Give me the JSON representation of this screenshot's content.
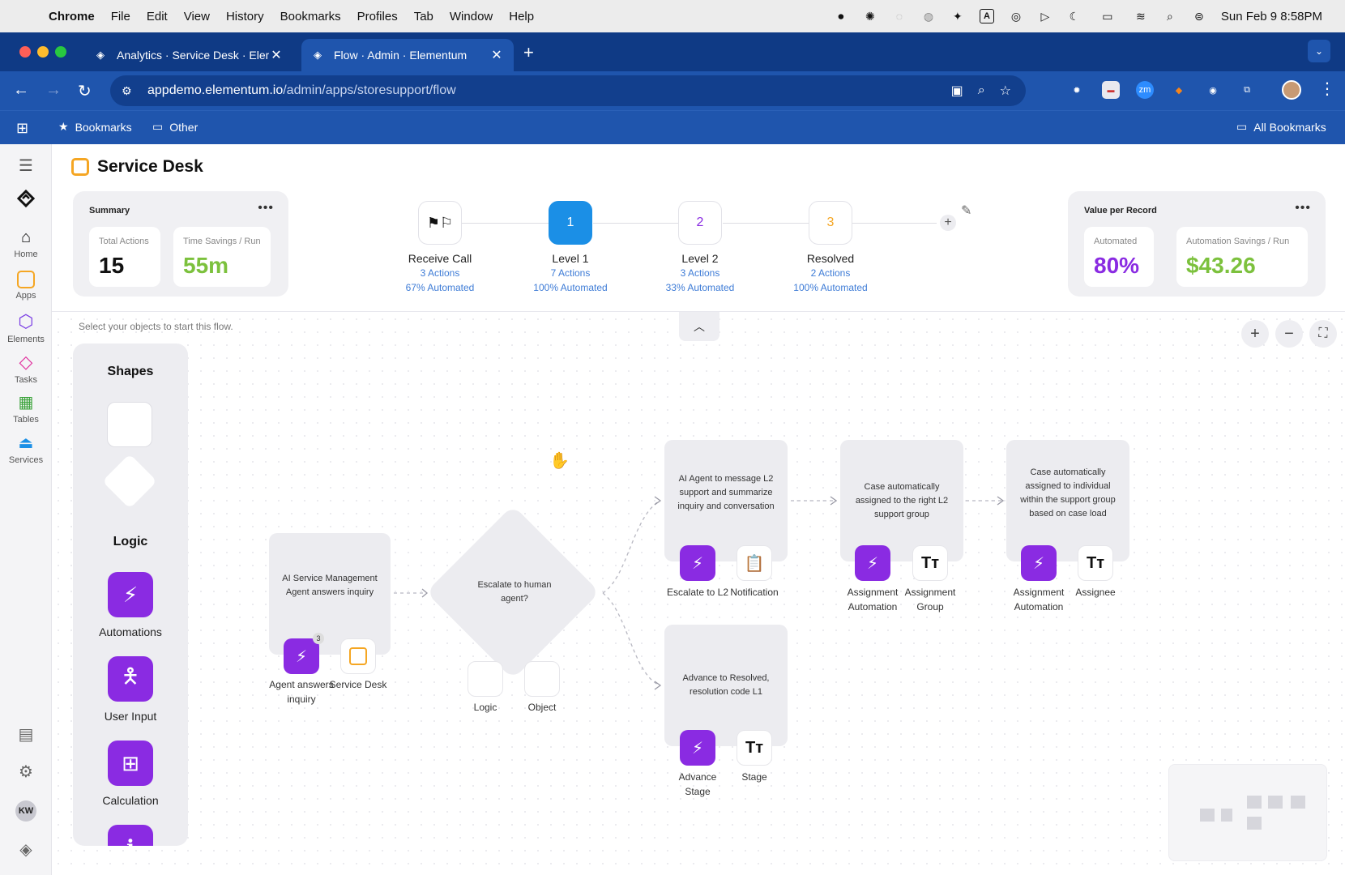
{
  "menubar": {
    "app": "Chrome",
    "items": [
      "File",
      "Edit",
      "View",
      "History",
      "Bookmarks",
      "Profiles",
      "Tab",
      "Window",
      "Help"
    ],
    "clock": "Sun Feb 9  8:58PM"
  },
  "browser": {
    "tabs": [
      {
        "label": "Analytics · Service Desk · Elementum"
      },
      {
        "label": "Flow · Admin · Elementum"
      }
    ],
    "url_host": "appdemo.elementum.io",
    "url_path": "/admin/apps/storesupport/flow",
    "bookmarks": {
      "bookmarks": "Bookmarks",
      "other": "Other",
      "all": "All Bookmarks"
    },
    "extensions": {
      "zm": "zm"
    }
  },
  "rail": {
    "items": [
      "Home",
      "Apps",
      "Elements",
      "Tasks",
      "Tables",
      "Services"
    ],
    "avatar": "KW"
  },
  "header": {
    "title": "Service Desk"
  },
  "summary": {
    "title": "Summary",
    "total_actions_label": "Total Actions",
    "total_actions": "15",
    "time_savings_label": "Time Savings / Run",
    "time_savings": "55m"
  },
  "stages": [
    {
      "badge": "",
      "name": "Receive Call",
      "actions": "3 Actions",
      "automated": "67% Automated"
    },
    {
      "badge": "1",
      "name": "Level 1",
      "actions": "7 Actions",
      "automated": "100% Automated"
    },
    {
      "badge": "2",
      "name": "Level 2",
      "actions": "3 Actions",
      "automated": "33% Automated"
    },
    {
      "badge": "3",
      "name": "Resolved",
      "actions": "2 Actions",
      "automated": "100% Automated"
    }
  ],
  "value_card": {
    "title": "Value per Record",
    "automated_label": "Automated",
    "automated": "80%",
    "savings_label": "Automation Savings / Run",
    "savings": "$43.26"
  },
  "canvas": {
    "hint": "Select your objects to start this flow."
  },
  "shapes_panel": {
    "shapes_heading": "Shapes",
    "logic_heading": "Logic",
    "tools": [
      "Automations",
      "User Input",
      "Calculation"
    ]
  },
  "flow": {
    "node_ai": {
      "text": "AI Service Management Agent answers inquiry",
      "chip1": "Agent answers inquiry",
      "chip1_count": "3",
      "chip2": "Service Desk"
    },
    "decision": {
      "text": "Escalate to human agent?",
      "chip1": "Logic",
      "chip2": "Object"
    },
    "node_l2": {
      "text": "AI Agent to message L2 support and summarize inquiry and conversation",
      "chip1": "Escalate to L2",
      "chip2": "Notification"
    },
    "node_group": {
      "text": "Case automatically assigned to the right L2 support group",
      "chip1": "Assignment Automation",
      "chip2": "Assignment Group"
    },
    "node_individual": {
      "text": "Case automatically assigned to individual within the support group based on case load",
      "chip1": "Assignment Automation",
      "chip2": "Assignee"
    },
    "node_resolved": {
      "text": "Advance to Resolved, resolution code L1",
      "chip1": "Advance Stage",
      "chip2": "Stage"
    }
  },
  "colors": {
    "accent_purple": "#8a2be2",
    "accent_green": "#7cc13d",
    "brand_blue": "#1f55ad",
    "stage_blue": "#1b8fe6"
  }
}
